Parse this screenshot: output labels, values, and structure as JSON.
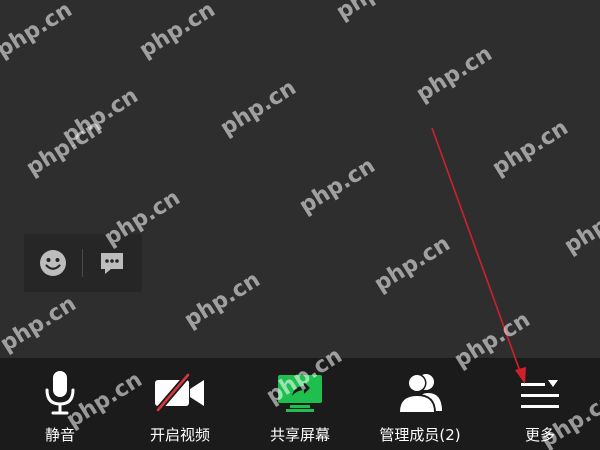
{
  "watermark_text": "php.cn",
  "colors": {
    "background": "#2e2e2e",
    "toolbar": "#1b1b1b",
    "share_green": "#1fbf4f",
    "camera_off_red": "#d9363e",
    "annotation_arrow": "#d0212b"
  },
  "quick_actions": [
    {
      "icon": "emoji-icon"
    },
    {
      "icon": "chat-icon"
    }
  ],
  "toolbar": {
    "mute_label": "静音",
    "video_label": "开启视频",
    "share_label": "共享屏幕",
    "members_label": "管理成员(2)",
    "more_label": "更多"
  }
}
